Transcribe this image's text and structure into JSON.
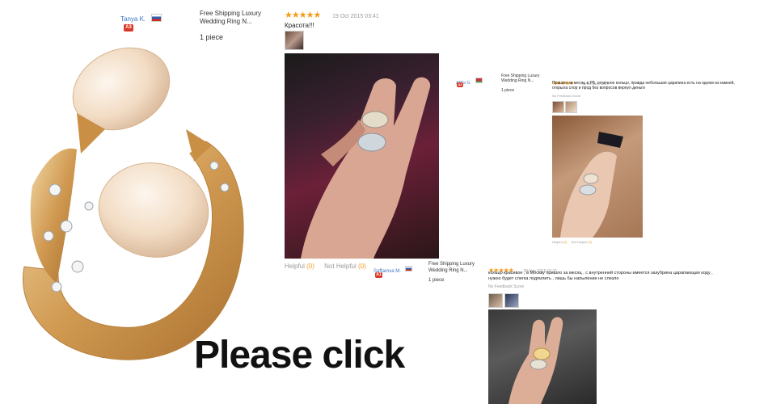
{
  "review1": {
    "user": "Tanya K.",
    "badge": "A3",
    "product": "Free Shipping Luxury Wedding Ring N...",
    "quantity": "1 piece",
    "stars": "★★★★★",
    "date": "19 Oct 2015 03:41",
    "comment": "Красота!!!",
    "helpful_label": "Helpful",
    "helpful_count": "(0)",
    "not_helpful_label": "Not Helpful",
    "not_helpful_count": "(0)"
  },
  "review2": {
    "user": "A***a G.",
    "badge": "A3",
    "product": "Free Shipping Luxury Wedding Ring N...",
    "quantity": "1 piece",
    "stars": "★★★★★",
    "date": "26 Oct 2015 08:14",
    "comment": "Пришло за месяц в РБ, отличное кольцо, правда небольшая царапина есть на одном из камней, открыла спор и прод без вопросов вернул деньги",
    "feedback_score": "No Feedback Score",
    "helpful_label": "Helpful",
    "helpful_count": "(0)",
    "not_helpful_label": "Not Helpful",
    "not_helpful_count": "(0)"
  },
  "review3": {
    "user": "Saffarova M.",
    "badge": "A1",
    "product": "Free Shipping Luxury Wedding Ring N...",
    "quantity": "1 piece",
    "stars": "★★★★★",
    "date": "29 Nov 2015 01:11",
    "comment": "кольцо красивое , в Москву пришло за месяц , с внутренней стороны имеется зазубрина царапающая коду , нужно будет слегка подпилить , лишь бы напыление не слезло",
    "feedback_score": "No Feedback Score"
  },
  "banner": {
    "text": "Please click"
  },
  "colors": {
    "link_blue": "#3a78c2",
    "star_orange": "#f39c1b",
    "badge_red": "#d9392b",
    "gold": "#d9a85a",
    "opal": "#f3dcc4"
  }
}
